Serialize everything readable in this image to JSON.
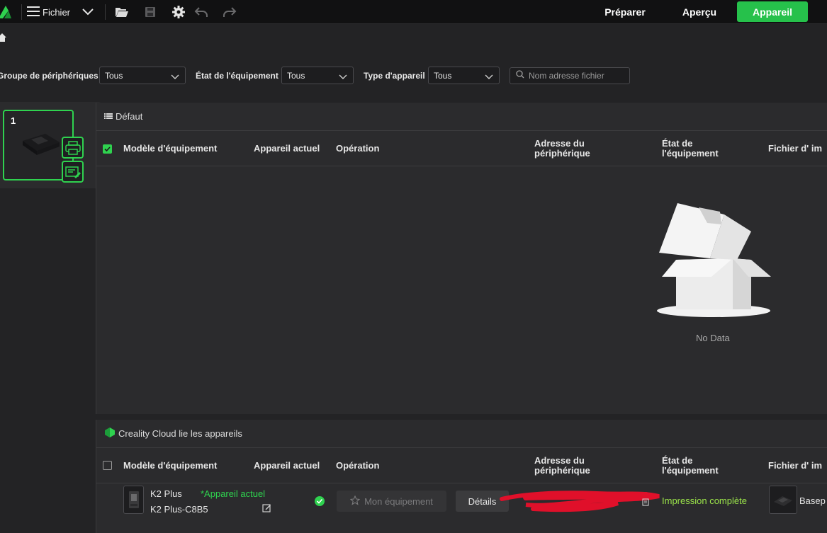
{
  "topbar": {
    "file_label": "Fichier",
    "nav": {
      "prepare": "Préparer",
      "preview": "Aperçu",
      "device": "Appareil"
    },
    "accent": "#26c14b"
  },
  "filters": {
    "group_label": "Groupe de périphériques",
    "group_value": "Tous",
    "state_label": "État de l'équipement",
    "state_value": "Tous",
    "type_label": "Type d'appareil",
    "type_value": "Tous",
    "search_placeholder": "Nom adresse fichier"
  },
  "sidebar": {
    "group_number": "1"
  },
  "columns": {
    "model": "Modèle d'équipement",
    "current": "Appareil actuel",
    "operation": "Opération",
    "address_line1": "Adresse du",
    "address_line2": "périphérique",
    "state_line1": "État de",
    "state_line2": "l'équipement",
    "file": "Fichier d' im"
  },
  "default_panel": {
    "title": "Défaut",
    "empty_text": "No Data"
  },
  "cloud_panel": {
    "title": "Creality Cloud lie les appareils",
    "devices": [
      {
        "model": "K2 Plus",
        "name": "K2 Plus-C8B5",
        "current_tag": "*Appareil actuel",
        "fav_label": "Mon équipement",
        "details_label": "Détails",
        "status": "Impression complète",
        "file": "Basep"
      }
    ]
  },
  "colors": {
    "success": "#2fd24f",
    "status_complete": "#9be44a",
    "redaction": "#e0102a"
  }
}
